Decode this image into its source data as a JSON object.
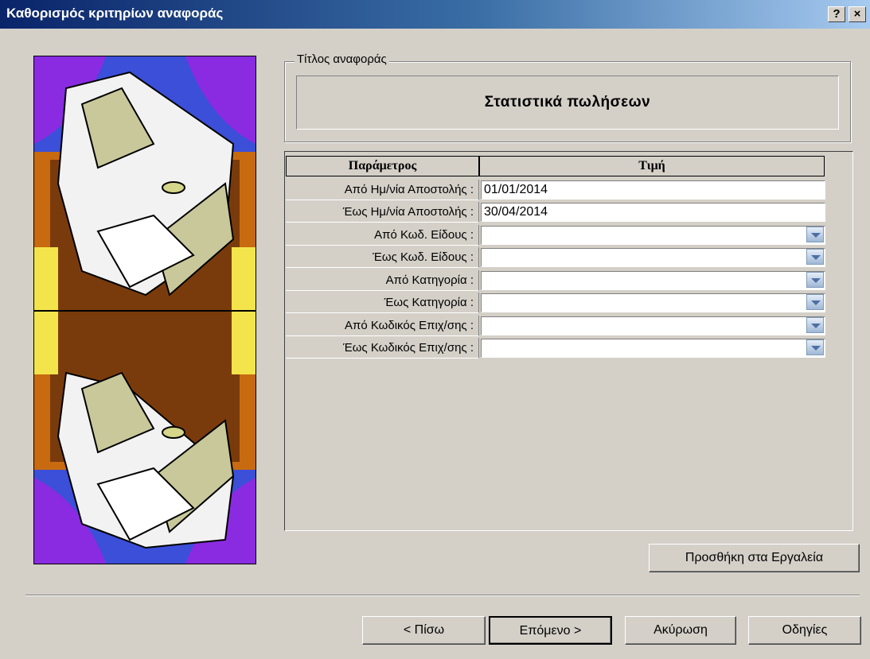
{
  "window": {
    "title": "Καθορισμός κριτηρίων αναφοράς",
    "help_button": "?",
    "close_button": "×"
  },
  "report_group": {
    "label": "Τίτλος αναφοράς",
    "title": "Στατιστικά πωλήσεων"
  },
  "grid": {
    "header_param": "Παράμετρος",
    "header_value": "Τιμή",
    "rows": [
      {
        "param": "Από Ημ/νία Αποστολής :",
        "value": "01/01/2014"
      },
      {
        "param": "Έως Ημ/νία Αποστολής :",
        "value": "30/04/2014"
      },
      {
        "param": "Από Κωδ. Είδους :",
        "value": ""
      },
      {
        "param": "Έως Κωδ. Είδους :",
        "value": ""
      },
      {
        "param": "Από Κατηγορία :",
        "value": ""
      },
      {
        "param": "Έως Κατηγορία :",
        "value": ""
      },
      {
        "param": "Από Κωδικός Επιχ/σης :",
        "value": ""
      },
      {
        "param": "Έως Κωδικός Επιχ/σης :",
        "value": ""
      }
    ]
  },
  "buttons": {
    "add_tools": "Προσθήκη στα Εργαλεία",
    "back": "< Πίσω",
    "next": "Επόμενο >",
    "cancel": "Ακύρωση",
    "help": "Οδηγίες"
  }
}
